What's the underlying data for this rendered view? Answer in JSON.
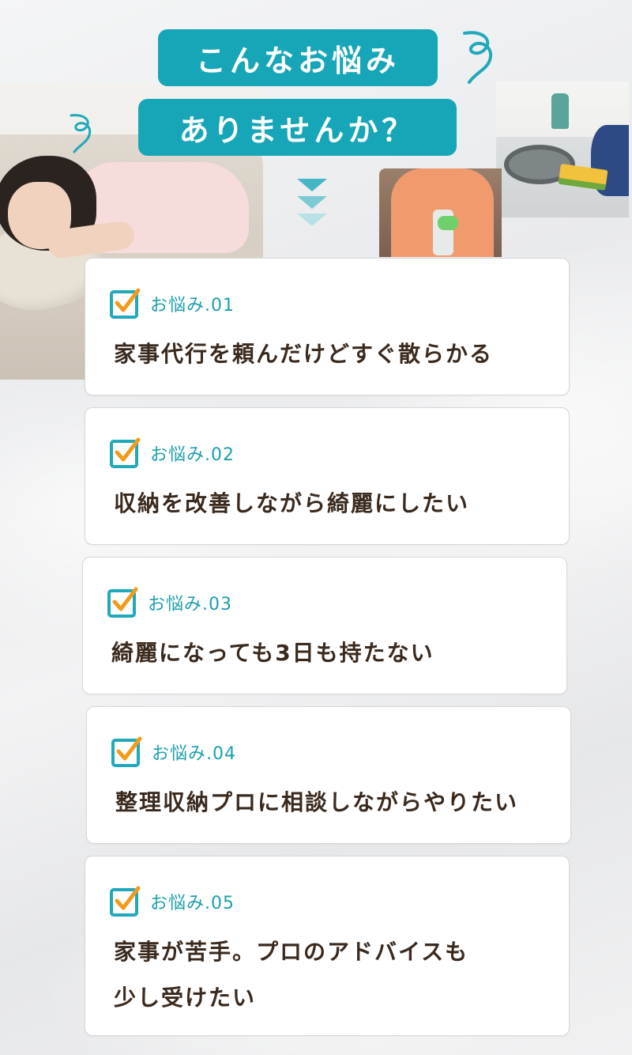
{
  "title": {
    "line1": "こんなお悩み",
    "line2": "ありませんか？"
  },
  "colors": {
    "accent": "#17a6b8",
    "check_orange": "#f29b1b",
    "text_dark": "#3a2a1e"
  },
  "photos": [
    {
      "name": "woman-lying-on-sofa"
    },
    {
      "name": "person-cleaning-with-spray"
    },
    {
      "name": "dishes-in-sink"
    }
  ],
  "worries": [
    {
      "label": "お悩み.01",
      "lines": [
        "家事代行を頼んだけどすぐ散らかる"
      ]
    },
    {
      "label": "お悩み.02",
      "lines": [
        "収納を改善しながら綺麗にしたい"
      ]
    },
    {
      "label": "お悩み.03",
      "lines": [
        "綺麗になっても3日も持たない"
      ]
    },
    {
      "label": "お悩み.04",
      "lines": [
        "整理収納プロに相談しながらやりたい"
      ]
    },
    {
      "label": "お悩み.05",
      "lines": [
        "家事が苦手。プロのアドバイスも",
        "少し受けたい"
      ]
    }
  ]
}
